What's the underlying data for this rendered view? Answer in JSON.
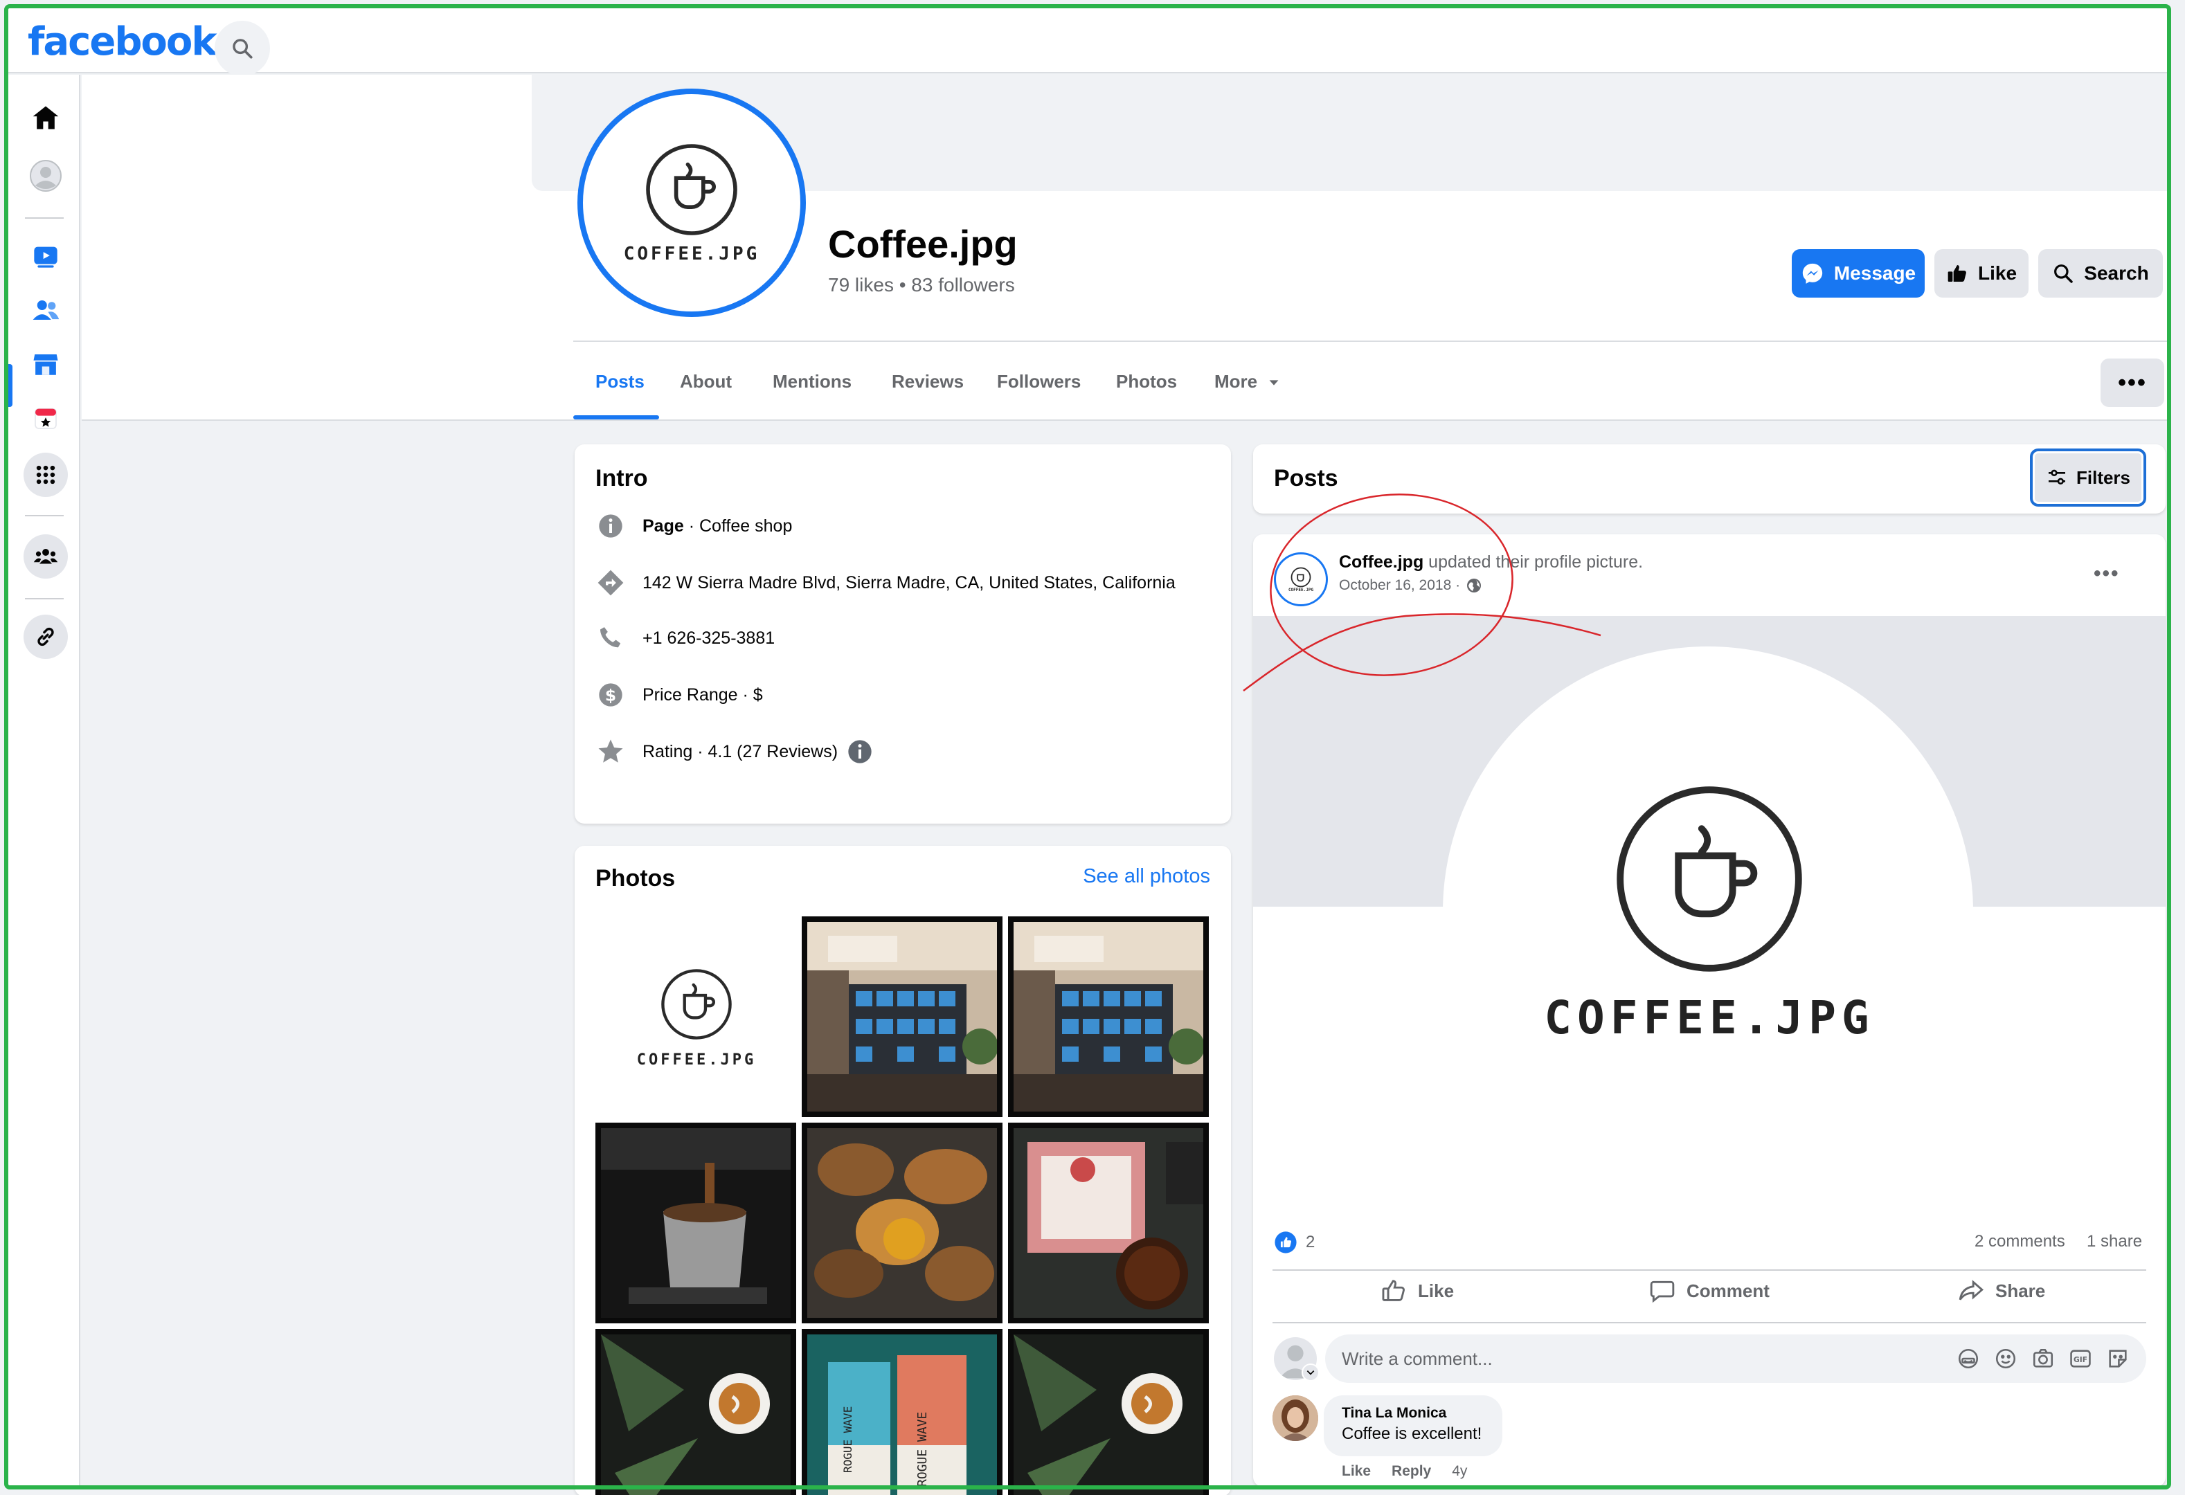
{
  "brand": {
    "logo": "facebook"
  },
  "nav_icons": [
    "home-icon",
    "profile-icon",
    "watch-icon",
    "friends-icon",
    "marketplace-icon",
    "events-icon",
    "menu-grid-icon",
    "groups-icon",
    "link-icon"
  ],
  "page": {
    "avatar_text": "COFFEE.JPG",
    "name": "Coffee.jpg",
    "stats": "79 likes • 83 followers",
    "buttons": {
      "message": "Message",
      "like": "Like",
      "search": "Search"
    },
    "more_dots": "•••"
  },
  "tabs": [
    "Posts",
    "About",
    "Mentions",
    "Reviews",
    "Followers",
    "Photos",
    "More"
  ],
  "intro": {
    "title": "Intro",
    "category_prefix": "Page",
    "category": " · Coffee shop",
    "address": "142 W Sierra Madre Blvd, Sierra Madre, CA, United States, California",
    "phone": "+1 626-325-3881",
    "price": "Price Range · $",
    "rating": "Rating · 4.1 (27 Reviews)"
  },
  "photos": {
    "title": "Photos",
    "see_all": "See all photos",
    "logo_text": "COFFEE.JPG",
    "bag_text": "ROGUE WAVE"
  },
  "posts": {
    "title": "Posts",
    "filters": "Filters",
    "author": "Coffee.jpg",
    "action": " updated their profile picture.",
    "date": "October 16, 2018 ·",
    "avatar_text": "COFFEE.JPG",
    "image_text": "COFFEE.JPG",
    "reaction_count": "2",
    "comments_count": "2 comments",
    "shares_count": "1 share",
    "like_label": "Like",
    "comment_label": "Comment",
    "share_label": "Share",
    "comment_placeholder": "Write a comment...",
    "comment": {
      "author": "Tina La Monica",
      "text": "Coffee is excellent!",
      "like": "Like",
      "reply": "Reply",
      "age": "4y"
    }
  },
  "colors": {
    "brand_blue": "#1877f2",
    "annotation_red": "#d9262b",
    "frame_green": "#2bb34a"
  }
}
